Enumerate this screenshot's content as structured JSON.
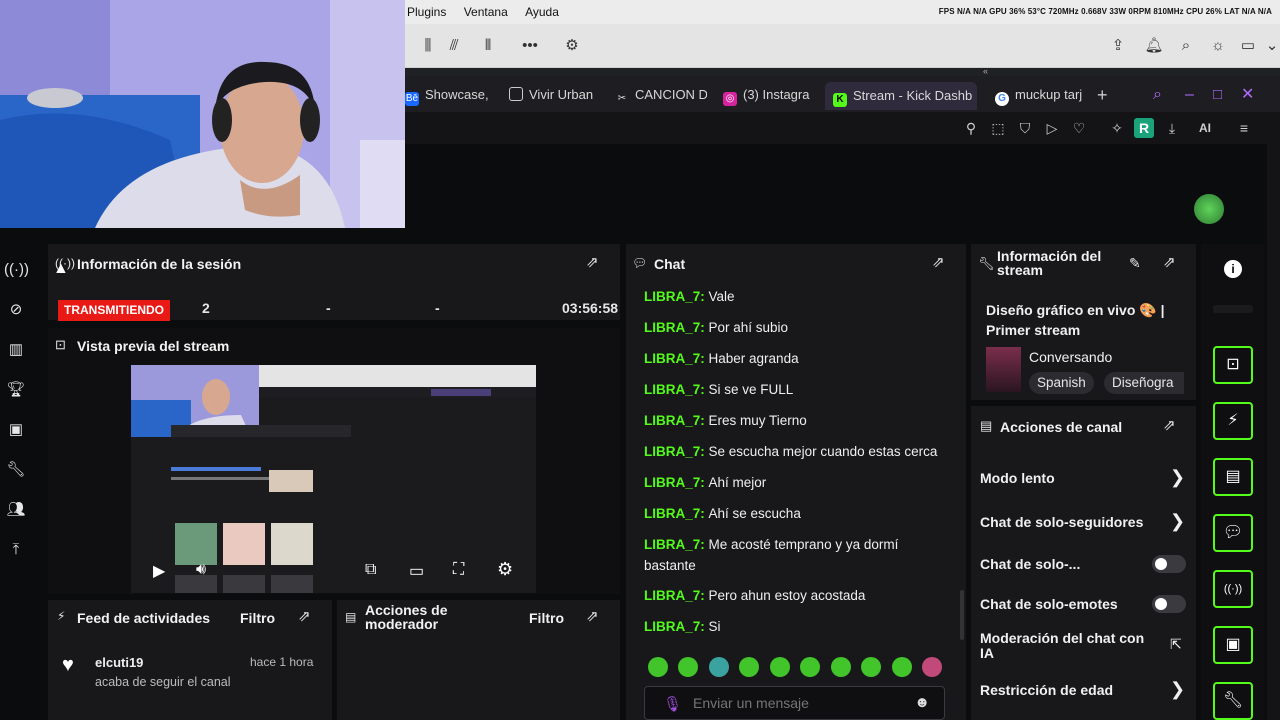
{
  "os": {
    "menus": [
      "Plugins",
      "Ventana",
      "Ayuda"
    ],
    "stats": "FPS  N/A  N/A    GPU 36% 53°C 720MHz 0.668V 33W 0RPM 810MHz    CPU 26%    LAT N/A  N/A"
  },
  "tabs": [
    {
      "label": "Showcase,",
      "icon": "behance-icon"
    },
    {
      "label": "Vivir Urban",
      "icon": "document-icon"
    },
    {
      "label": "CANCION D",
      "icon": "capcut-icon"
    },
    {
      "label": "(3) Instagra",
      "icon": "instagram-icon"
    },
    {
      "label": "Stream - Kick Dashb",
      "icon": "kick-icon",
      "active": true
    },
    {
      "label": "muckup tarj",
      "icon": "google-icon"
    }
  ],
  "profile_letter": "R",
  "ai_label": "AI",
  "session": {
    "title": "Información de la sesión",
    "status_badge": "TRANSMITIENDO",
    "viewers": "2",
    "stat2": "-",
    "stat3": "-",
    "time": "03:56:58"
  },
  "preview": {
    "title": "Vista previa del stream"
  },
  "feed": {
    "title": "Feed de actividades",
    "filter": "Filtro",
    "items": [
      {
        "user": "elcuti19",
        "when": "hace 1 hora",
        "text": "acaba de seguir el canal"
      }
    ]
  },
  "modactions": {
    "title": "Acciones de moderador",
    "filter": "Filtro"
  },
  "chat": {
    "title": "Chat",
    "messages": [
      {
        "user": "LIBRA_7",
        "text": "Vale"
      },
      {
        "user": "LIBRA_7",
        "text": "Por ahí subio"
      },
      {
        "user": "LIBRA_7",
        "text": "Haber agranda"
      },
      {
        "user": "LIBRA_7",
        "text": "Si se ve FULL"
      },
      {
        "user": "LIBRA_7",
        "text": "Eres muy Tierno"
      },
      {
        "user": "LIBRA_7",
        "text": "Se escucha mejor cuando estas cerca"
      },
      {
        "user": "LIBRA_7",
        "text": "Ahí mejor"
      },
      {
        "user": "LIBRA_7",
        "text": "Ahí se escucha"
      },
      {
        "user": "LIBRA_7",
        "text": "Me acosté temprano y ya dormí bastante"
      },
      {
        "user": "LIBRA_7",
        "text": "Pero ahun estoy acostada"
      },
      {
        "user": "LIBRA_7",
        "text": "Si"
      }
    ],
    "placeholder": "Enviar un mensaje"
  },
  "streaminfo": {
    "title": "Información del stream",
    "stream_title": "Diseño gráfico en vivo 🎨 | Primer stream",
    "category": "Conversando",
    "tags": [
      "Spanish",
      "Diseñogra"
    ]
  },
  "channel_actions": {
    "title": "Acciones de canal",
    "items": [
      {
        "label": "Modo lento",
        "control": "chevron"
      },
      {
        "label": "Chat de solo-seguidores",
        "control": "chevron"
      },
      {
        "label": "Chat de solo-...",
        "control": "toggle",
        "on": false
      },
      {
        "label": "Chat de solo-emotes",
        "control": "toggle",
        "on": false
      },
      {
        "label": "Moderación del chat con IA",
        "control": "external"
      },
      {
        "label": "Restricción de edad",
        "control": "chevron"
      }
    ]
  },
  "colors": {
    "accent": "#53fc18",
    "live": "#e91916",
    "panel": "#18181b",
    "bg": "#0b0c0e"
  }
}
